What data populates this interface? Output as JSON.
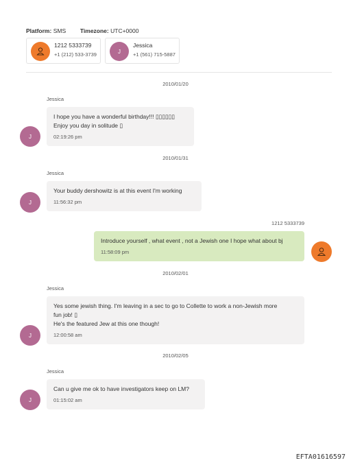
{
  "header": {
    "platform_label": "Platform:",
    "platform_value": "SMS",
    "timezone_label": "Timezone:",
    "timezone_value": "UTC+0000"
  },
  "participants": [
    {
      "name": "1212 5333739",
      "number": "+1 (212) 533-3739",
      "avatar": "person-icon",
      "color": "#ee7a2b"
    },
    {
      "name": "Jessica",
      "number": "+1 (561) 715-5887",
      "avatar_letter": "J",
      "color": "#b36a92"
    }
  ],
  "messages": [
    {
      "date": "2010/01/20",
      "sender": "Jessica",
      "line1": "I hope you have a wonderful birthday!!! ▯▯▯▯▯▯",
      "line2": "Enjoy you day in solitude ▯",
      "time": "02:19:26 pm",
      "avatar_letter": "J"
    },
    {
      "date": "2010/01/31",
      "sender": "Jessica",
      "line1": "Your buddy dershowitz is at this event I'm working",
      "time": "11:56:32 pm",
      "avatar_letter": "J"
    },
    {
      "sender": "1212 5333739",
      "line1": "Introduce yourself , what event , not a Jewish one I hope what about bj",
      "time": "11:58:09 pm"
    },
    {
      "date": "2010/02/01",
      "sender": "Jessica",
      "line1": "Yes some jewish thing. I'm leaving in a sec to go to Collette to work a non-Jewish more",
      "line2": "fun job! ▯",
      "line3": "He's the featured Jew at this one though!",
      "time": "12:00:58 am",
      "avatar_letter": "J"
    },
    {
      "date": "2010/02/05",
      "sender": "Jessica",
      "line1": "Can u give me ok to have investigators keep on LM?",
      "time": "01:15:02 am",
      "avatar_letter": "J"
    }
  ],
  "footer_id": "EFTA01616597"
}
